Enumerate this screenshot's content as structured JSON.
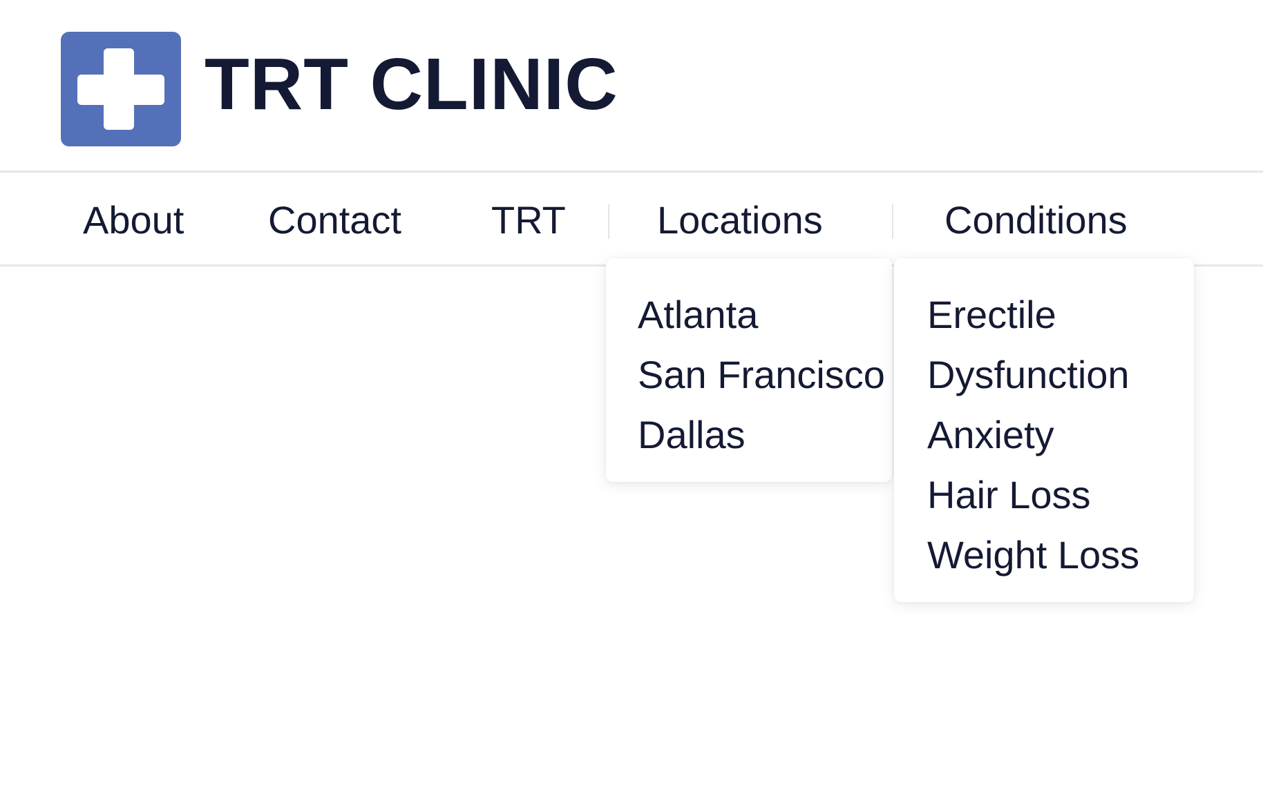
{
  "brand": {
    "name": "TRT CLINIC",
    "logo_icon": "medical-cross-icon",
    "logo_color": "#5470b8",
    "text_color": "#141a33"
  },
  "nav": {
    "items": [
      {
        "label": "About"
      },
      {
        "label": "Contact"
      },
      {
        "label": "TRT"
      },
      {
        "label": "Locations"
      },
      {
        "label": "Conditions"
      }
    ]
  },
  "locations_menu": {
    "items": [
      "Atlanta",
      "San Francisco",
      "Dallas"
    ]
  },
  "conditions_menu": {
    "items": [
      "Erectile",
      "Dysfunction",
      "Anxiety",
      "Hair Loss",
      "Weight Loss"
    ]
  }
}
